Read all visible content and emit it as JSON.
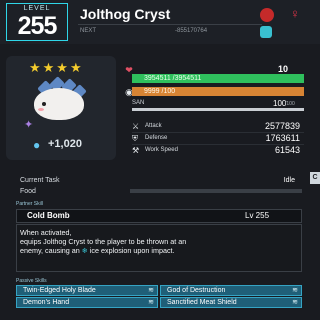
{
  "header": {
    "level_label": "LEVEL",
    "level": "255",
    "name": "Jolthog Cryst",
    "next_label": "NEXT",
    "next_value": "-855170764",
    "gender_icon": "female-icon"
  },
  "pal": {
    "stars": "★★★★",
    "condenser": "+1,020"
  },
  "stats": {
    "shield": "10",
    "hp_text": "3954511 /3954511",
    "hp_fraction": 1.0,
    "hunger_text": "9999 /100",
    "hunger_fraction": 1.0,
    "san_label": "SAN",
    "san_value": "100",
    "san_max": "/100",
    "attack_label": "Attack",
    "attack": "2577839",
    "defense_label": "Defense",
    "defense": "1763611",
    "work_label": "Work Speed",
    "work": "61543"
  },
  "task": {
    "current_label": "Current Task",
    "current": "Idle",
    "food_label": "Food",
    "side_tab": "C"
  },
  "partner": {
    "section_label": "Partner Skill",
    "name": "Cold Bomb",
    "level": "Lv 255",
    "desc_line1": "When activated,",
    "desc_line2": "equips Jolthog Cryst to the player to be thrown at an",
    "desc_line3a": "enemy, causing an ",
    "desc_line3_icon": "❄",
    "desc_line3b": " ice explosion upon impact."
  },
  "passives": {
    "section_label": "Passive Skills",
    "items": [
      "Twin-Edged Holy Blade",
      "God of Destruction",
      "Demon's Hand",
      "Sanctified Meat Shield"
    ]
  }
}
